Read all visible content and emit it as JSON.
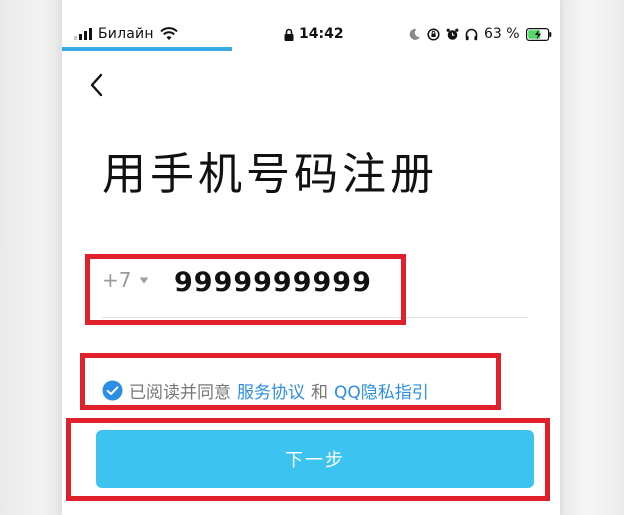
{
  "status_bar": {
    "carrier": "Билайн",
    "time": "14:42",
    "battery_percent": "63 %",
    "icons": [
      "signal-icon",
      "wifi-icon",
      "lock-icon",
      "moon-icon",
      "orientation-lock-icon",
      "alarm-icon",
      "headphones-icon",
      "battery-charging-icon"
    ]
  },
  "header": {
    "back_icon": "chevron-left-icon",
    "title": "用手机号码注册"
  },
  "phone_form": {
    "country_code": "+7",
    "phone_number": "9999999999"
  },
  "agreement": {
    "checked": true,
    "prefix": "已阅读并同意",
    "terms_link": "服务协议",
    "conjunction": "和",
    "privacy_link": "QQ隐私指引"
  },
  "next_button": {
    "label": "下一步"
  },
  "colors": {
    "accent": "#3cc3ef",
    "link": "#2b8ee4",
    "highlight": "#e0202a",
    "progress": "#3aa7e6"
  }
}
